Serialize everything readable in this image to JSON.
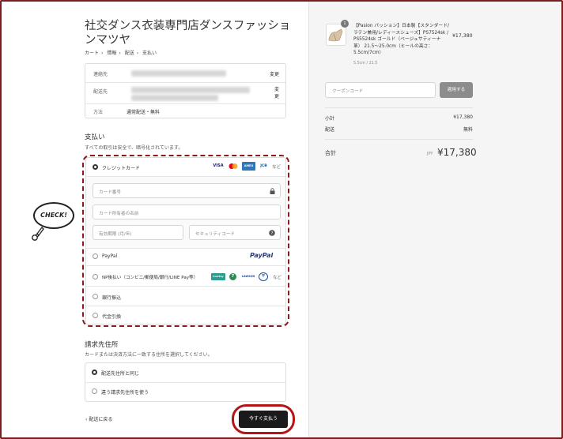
{
  "shop": {
    "title": "社交ダンス衣装専門店ダンスファッションマツヤ"
  },
  "breadcrumb": [
    "カート",
    "情報",
    "配送",
    "支払い"
  ],
  "info": {
    "contact_label": "連絡先",
    "shipto_label": "配送先",
    "method_label": "方法",
    "method_value": "通常配送・無料",
    "change_label": "変更",
    "change_label_split": [
      "変",
      "更"
    ]
  },
  "payment": {
    "heading": "支払い",
    "sub": "すべての取引は安全で、暗号化されています。",
    "credit_label": "クレジットカード",
    "card_brands": [
      "VISA",
      "MC",
      "AMEX",
      "JCB"
    ],
    "more": "など",
    "card_number_placeholder": "カード番号",
    "card_name_placeholder": "カード所有者の名前",
    "expiry_placeholder": "有効期限 (月/年)",
    "cvc_placeholder": "セキュリティコード",
    "paypal_label": "PayPal",
    "paypal_logo": "PayPal",
    "np_label": "NP後払い（コンビニ/郵便局/銀行/LINE Pay等）",
    "np_logos": [
      "PostPay",
      "7",
      "LAWSON",
      "〒"
    ],
    "bank_label": "銀行振込",
    "cod_label": "代金引換"
  },
  "callout": {
    "text": "CHECK!"
  },
  "billing": {
    "heading": "請求先住所",
    "sub": "カードまたは決済方法に一致する住所を選択してください。",
    "same_label": "配送先住所と同じ",
    "diff_label": "違う請求先住所を使う"
  },
  "nav": {
    "back_label": "配送に戻る",
    "pay_label": "今すぐ支払う"
  },
  "order": {
    "quantity": "1",
    "product_name": "【Pasion パッション】日本製【スタンダード/ラテン兼用/レディースシューズ】PS7524sk / PS5524sk ゴールド（ベージュサティーナ革） 21.5～25.0cm（ヒールの高さ：5.5cm/7cm）",
    "product_variant": "5.5cm / 21.5",
    "product_price": "¥17,380",
    "coupon_placeholder": "クーポンコード",
    "apply_label": "適用する",
    "subtotal_label": "小計",
    "subtotal_value": "¥17,380",
    "shipping_label": "配送",
    "shipping_value": "無料",
    "total_label": "合計",
    "total_currency": "JPY",
    "total_value": "¥17,380"
  },
  "colors": {
    "accent_red": "#b51515",
    "dash_red": "#8b1a1a",
    "button_dark": "#1a1a1a"
  }
}
